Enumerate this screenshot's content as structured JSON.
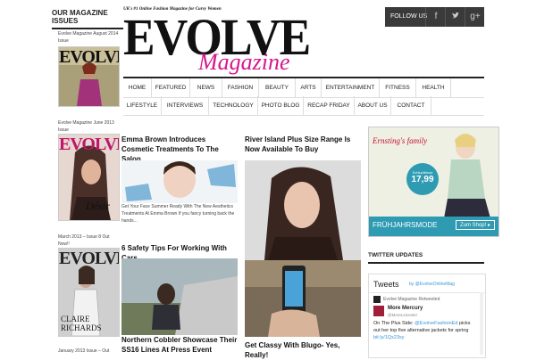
{
  "sidebar": {
    "title": "OUR MAGAZINE ISSUES",
    "issues": [
      {
        "caption": "Evolve Magazine August 2014 Issue",
        "cover_title": "EVOLVE",
        "cover_color": "#111111",
        "cover_bg": "#b8b090"
      },
      {
        "caption": "Evolve Magazine June 2013 Issue",
        "cover_title": "EVOLVE",
        "cover_color": "#c0166a",
        "cover_bg": "#3a2a28",
        "cover_footer": "Désir"
      },
      {
        "caption": "March 2013 – Issue 8 Out Now!!",
        "cover_title": "EVOLVE",
        "cover_color": "#222222",
        "cover_bg": "#d9d9d9",
        "cover_footer": "CLAIRE RICHARDS"
      },
      {
        "caption": "January 2013 Issue – Out"
      }
    ]
  },
  "header": {
    "tagline": "UK's #1 Online Fashion Magazine for Curvy Women",
    "logo": "EVOLVE",
    "logo_sub": "Magazine",
    "logo_sub_color": "#d6178f",
    "follow_label": "FOLLOW US",
    "social_icons": [
      "facebook-icon",
      "twitter-icon",
      "google-plus-icon"
    ]
  },
  "nav": {
    "row1": [
      "HOME",
      "FEATURED",
      "NEWS",
      "FASHION",
      "BEAUTY",
      "ARTS",
      "ENTERTAINMENT",
      "FITNESS",
      "HEALTH"
    ],
    "row2": [
      "LIFESTYLE",
      "INTERVIEWS",
      "TECHNOLOGY",
      "PHOTO BLOG",
      "RECAP FRIDAY",
      "ABOUT US",
      "CONTACT"
    ]
  },
  "articles": {
    "a1": {
      "title": "Emma Brown Introduces Cosmetic Treatments To The Salon",
      "excerpt": "Get Your Face Summer Ready With The New Aesthetics Treatments At Emma Brown If you fancy turning back the hands..."
    },
    "a2": {
      "title": "River Island Plus Size Range Is Now Available To Buy"
    },
    "a3": {
      "title": "6 Safety Tips For Working With Cars"
    },
    "a4": {
      "title": "Northern Cobbler Showcase Their SS16 Lines At Press Event"
    },
    "a5": {
      "title": "Get Classy With Blugo- Yes, Really!"
    }
  },
  "ad": {
    "brand": "Ernsting's family",
    "price_label": "Schlupfbluse",
    "price": "17,99",
    "banner": "FRÜHJAHRSMODE",
    "cta": "Zum Shop! ▸"
  },
  "twitter": {
    "section_title": "TWITTER UPDATES",
    "tweets_label": "Tweets",
    "by": "by @EvolveOnlineMag",
    "retweet_line": "Evolve Magazine Retweeted",
    "user_name": "More Mercury",
    "user_handle": "@MoreLeicester",
    "tweet_prefix": "On The Plus Side: ",
    "tweet_mention": "@EvolveFashionEd",
    "tweet_body": " picks out her top five alternative jackets for spring ",
    "tweet_link": "bit.ly/1Qx23sy"
  }
}
